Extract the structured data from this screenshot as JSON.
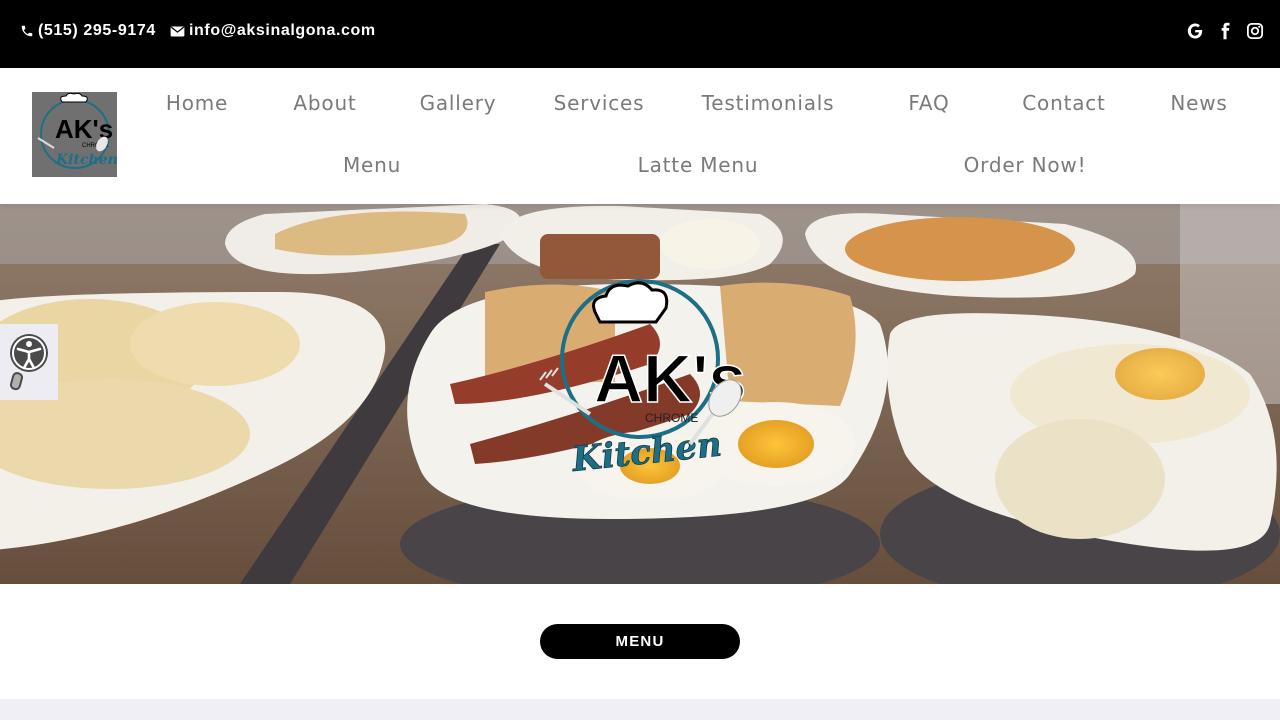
{
  "topbar": {
    "phone": "(515) 295-9174",
    "email": "info@aksinalgona.com",
    "social_icons": [
      "google-icon",
      "facebook-icon",
      "instagram-icon"
    ]
  },
  "nav": {
    "row1": [
      "Home",
      "About",
      "Gallery",
      "Services",
      "Testimonials",
      "FAQ",
      "Contact",
      "News"
    ],
    "row2": [
      "Menu",
      "Latte Menu",
      "Order Now!"
    ]
  },
  "logo": {
    "text_main": "AK's",
    "text_sub": "CHROME",
    "text_script": "Kitchen"
  },
  "hero": {
    "logo_text_main": "AK's",
    "logo_text_sub": "CHROME",
    "logo_text_script": "Kitchen"
  },
  "cta": {
    "menu_button": "MENU"
  },
  "colors": {
    "topbar_bg": "#000000",
    "nav_text": "#7a7a7a",
    "button_bg": "#000000",
    "logo_teal": "#1e6f86"
  }
}
